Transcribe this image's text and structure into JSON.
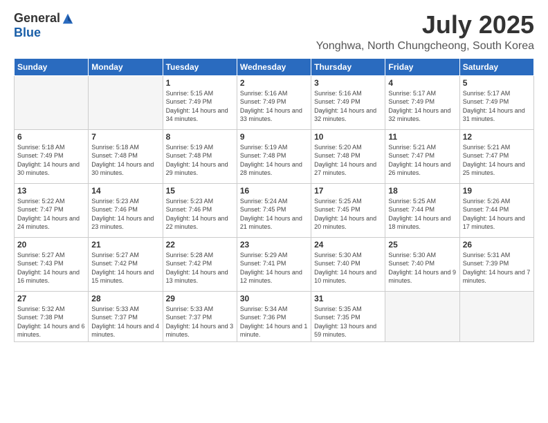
{
  "header": {
    "logo_general": "General",
    "logo_blue": "Blue",
    "month_title": "July 2025",
    "location": "Yonghwa, North Chungcheong, South Korea"
  },
  "days_of_week": [
    "Sunday",
    "Monday",
    "Tuesday",
    "Wednesday",
    "Thursday",
    "Friday",
    "Saturday"
  ],
  "weeks": [
    [
      {
        "day": "",
        "info": ""
      },
      {
        "day": "",
        "info": ""
      },
      {
        "day": "1",
        "info": "Sunrise: 5:15 AM\nSunset: 7:49 PM\nDaylight: 14 hours and 34 minutes."
      },
      {
        "day": "2",
        "info": "Sunrise: 5:16 AM\nSunset: 7:49 PM\nDaylight: 14 hours and 33 minutes."
      },
      {
        "day": "3",
        "info": "Sunrise: 5:16 AM\nSunset: 7:49 PM\nDaylight: 14 hours and 32 minutes."
      },
      {
        "day": "4",
        "info": "Sunrise: 5:17 AM\nSunset: 7:49 PM\nDaylight: 14 hours and 32 minutes."
      },
      {
        "day": "5",
        "info": "Sunrise: 5:17 AM\nSunset: 7:49 PM\nDaylight: 14 hours and 31 minutes."
      }
    ],
    [
      {
        "day": "6",
        "info": "Sunrise: 5:18 AM\nSunset: 7:49 PM\nDaylight: 14 hours and 30 minutes."
      },
      {
        "day": "7",
        "info": "Sunrise: 5:18 AM\nSunset: 7:48 PM\nDaylight: 14 hours and 30 minutes."
      },
      {
        "day": "8",
        "info": "Sunrise: 5:19 AM\nSunset: 7:48 PM\nDaylight: 14 hours and 29 minutes."
      },
      {
        "day": "9",
        "info": "Sunrise: 5:19 AM\nSunset: 7:48 PM\nDaylight: 14 hours and 28 minutes."
      },
      {
        "day": "10",
        "info": "Sunrise: 5:20 AM\nSunset: 7:48 PM\nDaylight: 14 hours and 27 minutes."
      },
      {
        "day": "11",
        "info": "Sunrise: 5:21 AM\nSunset: 7:47 PM\nDaylight: 14 hours and 26 minutes."
      },
      {
        "day": "12",
        "info": "Sunrise: 5:21 AM\nSunset: 7:47 PM\nDaylight: 14 hours and 25 minutes."
      }
    ],
    [
      {
        "day": "13",
        "info": "Sunrise: 5:22 AM\nSunset: 7:47 PM\nDaylight: 14 hours and 24 minutes."
      },
      {
        "day": "14",
        "info": "Sunrise: 5:23 AM\nSunset: 7:46 PM\nDaylight: 14 hours and 23 minutes."
      },
      {
        "day": "15",
        "info": "Sunrise: 5:23 AM\nSunset: 7:46 PM\nDaylight: 14 hours and 22 minutes."
      },
      {
        "day": "16",
        "info": "Sunrise: 5:24 AM\nSunset: 7:45 PM\nDaylight: 14 hours and 21 minutes."
      },
      {
        "day": "17",
        "info": "Sunrise: 5:25 AM\nSunset: 7:45 PM\nDaylight: 14 hours and 20 minutes."
      },
      {
        "day": "18",
        "info": "Sunrise: 5:25 AM\nSunset: 7:44 PM\nDaylight: 14 hours and 18 minutes."
      },
      {
        "day": "19",
        "info": "Sunrise: 5:26 AM\nSunset: 7:44 PM\nDaylight: 14 hours and 17 minutes."
      }
    ],
    [
      {
        "day": "20",
        "info": "Sunrise: 5:27 AM\nSunset: 7:43 PM\nDaylight: 14 hours and 16 minutes."
      },
      {
        "day": "21",
        "info": "Sunrise: 5:27 AM\nSunset: 7:42 PM\nDaylight: 14 hours and 15 minutes."
      },
      {
        "day": "22",
        "info": "Sunrise: 5:28 AM\nSunset: 7:42 PM\nDaylight: 14 hours and 13 minutes."
      },
      {
        "day": "23",
        "info": "Sunrise: 5:29 AM\nSunset: 7:41 PM\nDaylight: 14 hours and 12 minutes."
      },
      {
        "day": "24",
        "info": "Sunrise: 5:30 AM\nSunset: 7:40 PM\nDaylight: 14 hours and 10 minutes."
      },
      {
        "day": "25",
        "info": "Sunrise: 5:30 AM\nSunset: 7:40 PM\nDaylight: 14 hours and 9 minutes."
      },
      {
        "day": "26",
        "info": "Sunrise: 5:31 AM\nSunset: 7:39 PM\nDaylight: 14 hours and 7 minutes."
      }
    ],
    [
      {
        "day": "27",
        "info": "Sunrise: 5:32 AM\nSunset: 7:38 PM\nDaylight: 14 hours and 6 minutes."
      },
      {
        "day": "28",
        "info": "Sunrise: 5:33 AM\nSunset: 7:37 PM\nDaylight: 14 hours and 4 minutes."
      },
      {
        "day": "29",
        "info": "Sunrise: 5:33 AM\nSunset: 7:37 PM\nDaylight: 14 hours and 3 minutes."
      },
      {
        "day": "30",
        "info": "Sunrise: 5:34 AM\nSunset: 7:36 PM\nDaylight: 14 hours and 1 minute."
      },
      {
        "day": "31",
        "info": "Sunrise: 5:35 AM\nSunset: 7:35 PM\nDaylight: 13 hours and 59 minutes."
      },
      {
        "day": "",
        "info": ""
      },
      {
        "day": "",
        "info": ""
      }
    ]
  ]
}
